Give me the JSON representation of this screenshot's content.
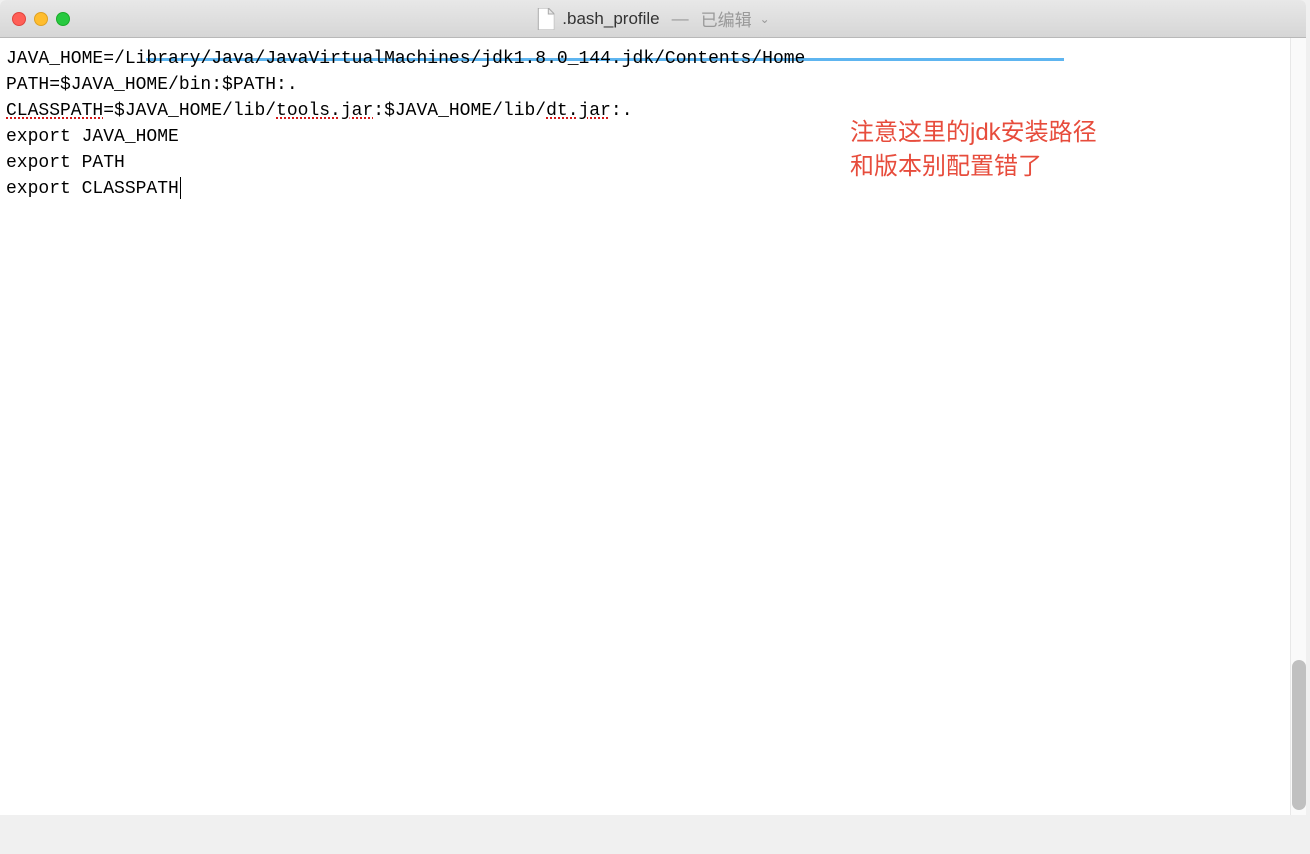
{
  "titlebar": {
    "filename": ".bash_profile",
    "separator": "—",
    "status": "已编辑"
  },
  "code": {
    "line1_key": "JAVA_HOME=",
    "line1_value": "/Library/Java/JavaVirtualMachines/jdk1.8.0_144.jdk/Contents/Home",
    "line2": "PATH=$JAVA_HOME/bin:$PATH:.",
    "line3_part1": "CLASSPATH",
    "line3_part2": "=$JAVA_HOME/lib/",
    "line3_part3": "tools.jar",
    "line3_part4": ":$JAVA_HOME/lib/",
    "line3_part5": "dt.jar",
    "line3_part6": ":.",
    "line4": "export JAVA_HOME",
    "line5": "export PATH",
    "line6": "export CLASSPATH"
  },
  "annotation": {
    "line1": "注意这里的jdk安装路径",
    "line2": "和版本别配置错了"
  }
}
